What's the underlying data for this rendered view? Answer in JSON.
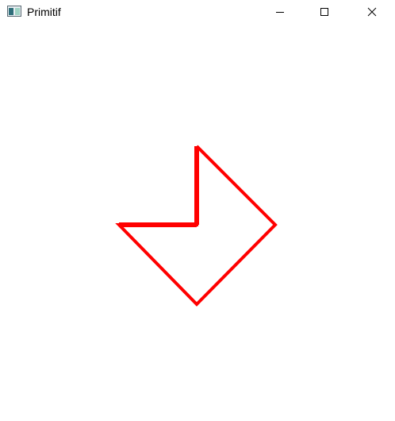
{
  "window": {
    "title": "Primitif",
    "controls": {
      "minimize": "minimize-icon",
      "maximize": "maximize-icon",
      "close": "close-icon"
    }
  },
  "drawing": {
    "stroke_color": "#ff0000"
  }
}
